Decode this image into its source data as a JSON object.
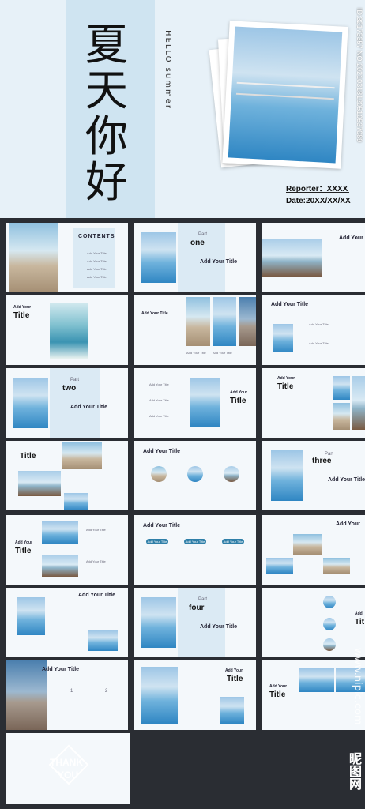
{
  "cover": {
    "title_chars": [
      "夏",
      "天",
      "你",
      "好"
    ],
    "vertical_text": "HELLO summer",
    "reporter": "Reporter：XXXX",
    "date": "Date:20XX/XX/XX",
    "watermark_id": "ID:32173357 NO:20210318120510537089"
  },
  "labels": {
    "contents": "CONTENTS",
    "add_your_title": "Add Your Title",
    "add_your": "Add Your",
    "title": "Title",
    "part": "Part",
    "add": "Add",
    "tit": "Tit",
    "one": "one",
    "two": "two",
    "three": "three",
    "four": "four",
    "thank": "THANK",
    "you": "YOU",
    "n1": "1",
    "n2": "2"
  },
  "watermark": {
    "url": "www.nipic.com",
    "brand": "昵图网"
  }
}
